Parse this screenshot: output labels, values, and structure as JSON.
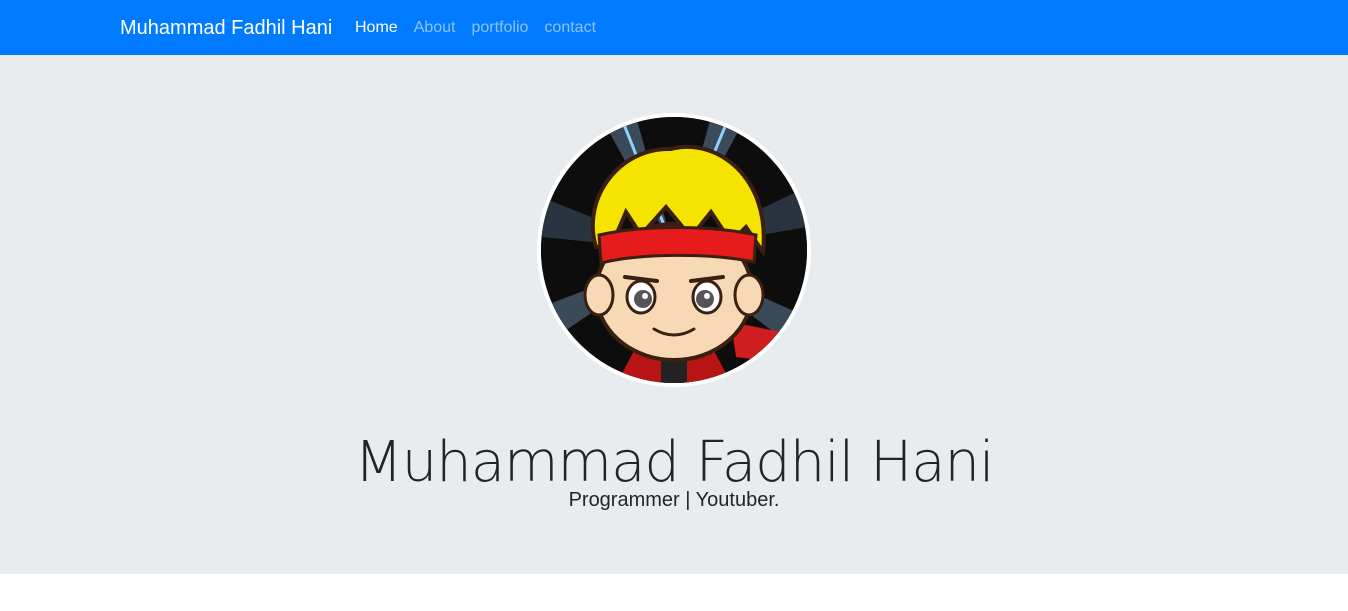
{
  "navbar": {
    "brand": "Muhammad Fadhil Hani",
    "links": [
      {
        "label": "Home",
        "active": true
      },
      {
        "label": "About",
        "active": false
      },
      {
        "label": "portfolio",
        "active": false
      },
      {
        "label": "contact",
        "active": false
      }
    ],
    "background_color": "#007bff"
  },
  "hero": {
    "avatar_icon": "cartoon-avatar-headband",
    "name": "Muhammad Fadhil Hani",
    "tagline": "Programmer | Youtuber.",
    "background_color": "#e9ecef"
  }
}
